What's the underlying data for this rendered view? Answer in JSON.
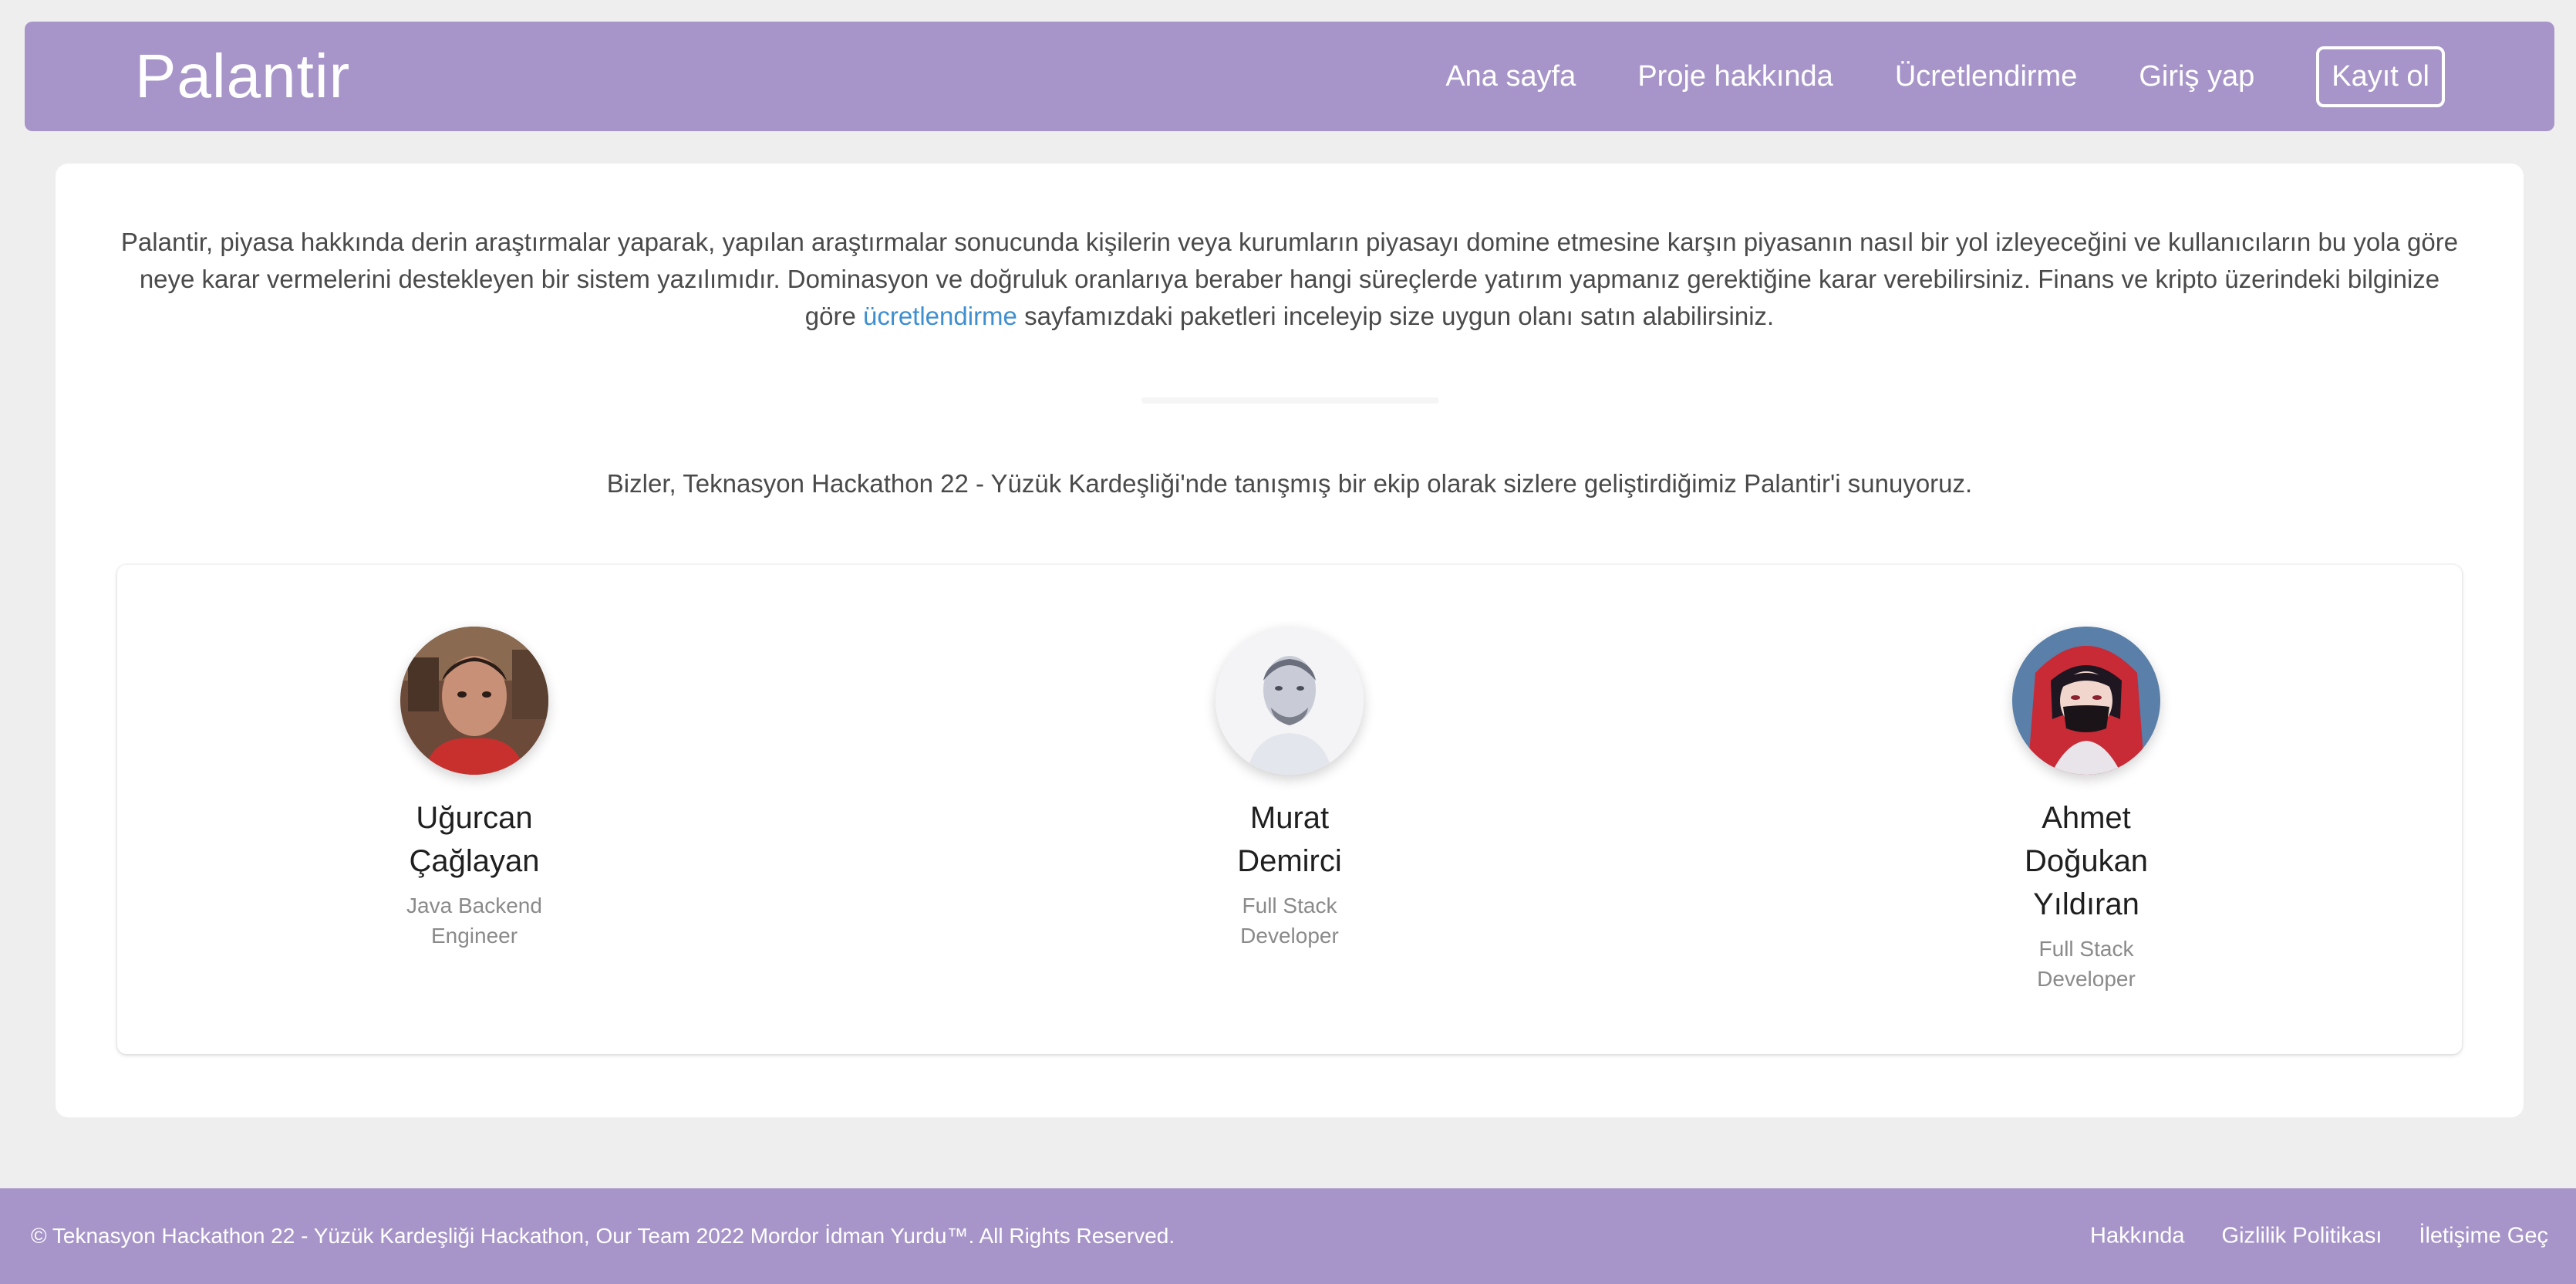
{
  "navbar": {
    "brand": "Palantir",
    "links": [
      "Ana sayfa",
      "Proje hakkında",
      "Ücretlendirme",
      "Giriş yap"
    ],
    "register_label": "Kayıt ol"
  },
  "intro": {
    "text_before": "Palantir, piyasa hakkında derin araştırmalar yaparak, yapılan araştırmalar sonucunda kişilerin veya kurumların piyasayı domine etmesine karşın piyasanın nasıl bir yol izleyeceğini ve kullanıcıların bu yola göre neye karar vermelerini destekleyen bir sistem yazılımıdır. Dominasyon ve doğruluk oranlarıya beraber hangi süreçlerde yatırım yapmanız gerektiğine karar verebilirsiniz. Finans ve kripto üzerindeki bilginize göre ",
    "link_text": "ücretlendirme",
    "text_after": " sayfamızdaki paketleri inceleyip size uygun olanı satın alabilirsiniz."
  },
  "team_text": "Bizler, Teknasyon Hackathon 22 - Yüzük Kardeşliği'nde tanışmış bir ekip olarak sizlere geliştirdiğimiz Palantir'i sunuyoruz.",
  "team": [
    {
      "name": "Uğurcan Çağlayan",
      "role": "Java Backend Engineer"
    },
    {
      "name": "Murat Demirci",
      "role": "Full Stack Developer"
    },
    {
      "name": "Ahmet Doğukan Yıldıran",
      "role": "Full Stack Developer"
    }
  ],
  "footer": {
    "copyright": "© Teknasyon Hackathon 22 - Yüzük Kardeşliği Hackathon, Our Team 2022 Mordor İdman Yurdu™. All Rights Reserved.",
    "links": [
      "Hakkında",
      "Gizlilik Politikası",
      "İletişime Geç"
    ]
  },
  "colors": {
    "primary": "#a795ca",
    "link": "#3e8ed0",
    "background": "#eeeeee"
  }
}
